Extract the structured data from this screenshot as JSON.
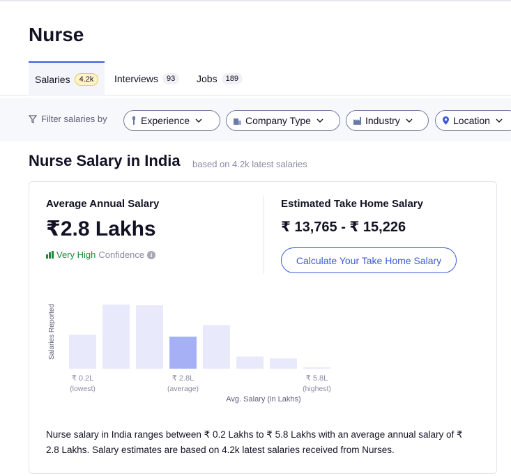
{
  "page_title": "Nurse",
  "tabs": [
    {
      "label": "Salaries",
      "count": "4.2k"
    },
    {
      "label": "Interviews",
      "count": "93"
    },
    {
      "label": "Jobs",
      "count": "189"
    }
  ],
  "filters": {
    "label": "Filter salaries by",
    "items": [
      {
        "label": "Experience",
        "icon": "experience-icon"
      },
      {
        "label": "Company Type",
        "icon": "building-icon"
      },
      {
        "label": "Industry",
        "icon": "factory-icon"
      },
      {
        "label": "Location",
        "icon": "location-pin-icon"
      }
    ]
  },
  "section": {
    "title": "Nurse Salary in India",
    "subtitle": "based on 4.2k latest salaries"
  },
  "summary": {
    "avg_label": "Average Annual Salary",
    "avg_value": "₹2.8 Lakhs",
    "confidence_level": "Very High",
    "confidence_word": "Confidence",
    "info_glyph": "i",
    "take_home_label": "Estimated Take Home Salary",
    "take_home_value": "₹ 13,765 - ₹ 15,226",
    "calc_button": "Calculate Your Take Home Salary"
  },
  "chart_data": {
    "type": "bar",
    "ylabel": "Salaries Reported",
    "xlabel": "Avg. Salary (in Lakhs)",
    "values": [
      0.53,
      1.0,
      0.99,
      0.5,
      0.68,
      0.19,
      0.16,
      0.02
    ],
    "highlight_index": 3,
    "tick_labels": [
      {
        "index": 0,
        "value": "₹ 0.2L",
        "note": "(lowest)"
      },
      {
        "index": 3,
        "value": "₹ 2.8L",
        "note": "(average)"
      },
      {
        "index": 7,
        "value": "₹ 5.8L",
        "note": "(highest)"
      }
    ],
    "colors": {
      "bar": "#e8eafc",
      "highlight": "#a6b1f5"
    }
  },
  "description": "Nurse salary in India ranges between ₹ 0.2 Lakhs to ₹ 5.8 Lakhs with an average annual salary of ₹ 2.8 Lakhs. Salary estimates are based on 4.2k latest salaries received from Nurses."
}
